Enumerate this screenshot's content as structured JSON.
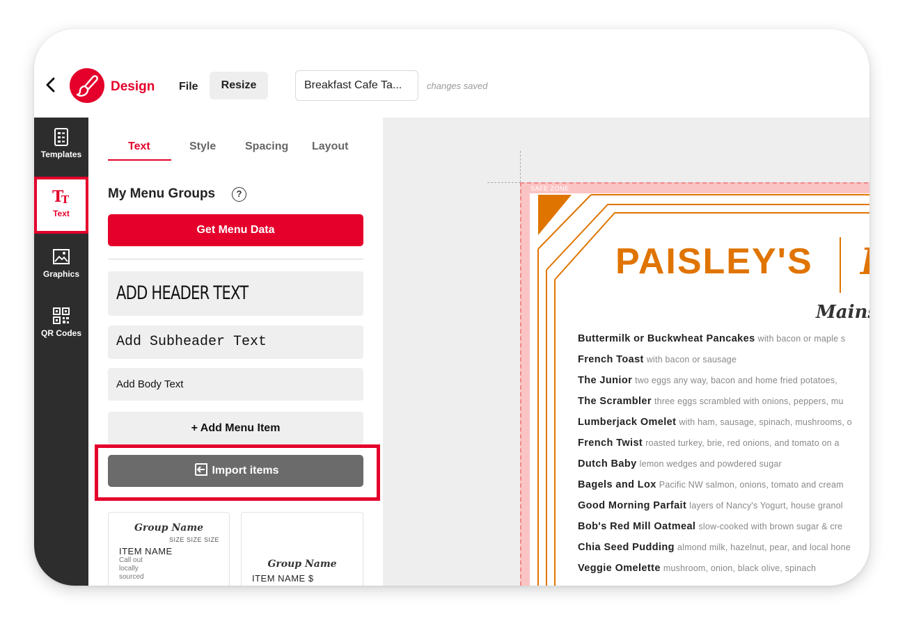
{
  "topbar": {
    "app_name": "Design",
    "file_label": "File",
    "resize_label": "Resize",
    "document_name": "Breakfast Cafe Ta...",
    "save_status": "changes saved",
    "brand_color": "#e4002b"
  },
  "rail": {
    "items": [
      {
        "label": "Templates",
        "icon": "templates-icon"
      },
      {
        "label": "Text",
        "icon": "text-icon",
        "active": true
      },
      {
        "label": "Graphics",
        "icon": "graphics-icon"
      },
      {
        "label": "QR Codes",
        "icon": "qr-code-icon"
      }
    ]
  },
  "panel": {
    "tabs": [
      "Text",
      "Style",
      "Spacing",
      "Layout"
    ],
    "active_tab": "Text",
    "groups_title": "My Menu Groups",
    "help_icon_text": "?",
    "get_menu_data_label": "Get Menu Data",
    "header_text": "ADD HEADER TEXT",
    "subheader_text": "Add Subheader Text",
    "body_text": "Add Body Text",
    "add_menu_item_label": "+ Add Menu Item",
    "import_items_label": "Import items",
    "card1": {
      "group_name": "Group Name",
      "sizes": "SIZE  SIZE  SIZE",
      "item_name": "ITEM NAME",
      "callout": [
        "Call out",
        "locally",
        "sourced"
      ]
    },
    "card2": {
      "group_name": "Group Name",
      "item_name": "ITEM NAME $"
    }
  },
  "canvas": {
    "safe_zone_label": "SAFE ZONE",
    "brand_name": "PAISLEY'S",
    "brand_suffix": "I",
    "section_title": "Mains",
    "accent_color": "#e07400",
    "menu_items": [
      {
        "name": "Buttermilk or Buckwheat Pancakes",
        "desc": "with bacon or maple s"
      },
      {
        "name": "French Toast",
        "desc": "with bacon or sausage"
      },
      {
        "name": "The Junior",
        "desc": "two eggs any way, bacon and home fried potatoes,"
      },
      {
        "name": "The Scrambler",
        "desc": "three eggs scrambled with onions, peppers, mu"
      },
      {
        "name": "Lumberjack Omelet",
        "desc": "with ham, sausage, spinach, mushrooms, o"
      },
      {
        "name": "French Twist",
        "desc": "roasted turkey, brie, red onions, and tomato on a"
      },
      {
        "name": "Dutch Baby",
        "desc": "lemon wedges and powdered sugar"
      },
      {
        "name": "Bagels and Lox",
        "desc": "Pacific NW salmon, onions, tomato and cream"
      },
      {
        "name": "Good Morning Parfait",
        "desc": "layers of Nancy's Yogurt, house granol"
      },
      {
        "name": "Bob's Red Mill Oatmeal",
        "desc": "slow-cooked with brown sugar & cre"
      },
      {
        "name": "Chia Seed Pudding",
        "desc": "almond milk, hazelnut, pear, and local hone"
      },
      {
        "name": "Veggie Omelette",
        "desc": "mushroom, onion, black olive, spinach"
      }
    ]
  }
}
